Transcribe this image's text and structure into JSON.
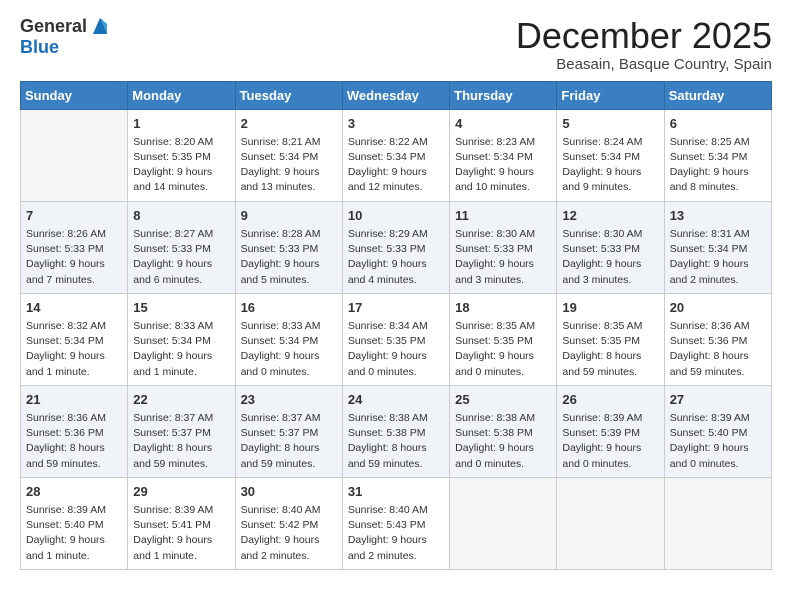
{
  "header": {
    "logo_general": "General",
    "logo_blue": "Blue",
    "month_title": "December 2025",
    "location": "Beasain, Basque Country, Spain"
  },
  "days_of_week": [
    "Sunday",
    "Monday",
    "Tuesday",
    "Wednesday",
    "Thursday",
    "Friday",
    "Saturday"
  ],
  "weeks": [
    [
      {
        "day": "",
        "info": ""
      },
      {
        "day": "1",
        "info": "Sunrise: 8:20 AM\nSunset: 5:35 PM\nDaylight: 9 hours\nand 14 minutes."
      },
      {
        "day": "2",
        "info": "Sunrise: 8:21 AM\nSunset: 5:34 PM\nDaylight: 9 hours\nand 13 minutes."
      },
      {
        "day": "3",
        "info": "Sunrise: 8:22 AM\nSunset: 5:34 PM\nDaylight: 9 hours\nand 12 minutes."
      },
      {
        "day": "4",
        "info": "Sunrise: 8:23 AM\nSunset: 5:34 PM\nDaylight: 9 hours\nand 10 minutes."
      },
      {
        "day": "5",
        "info": "Sunrise: 8:24 AM\nSunset: 5:34 PM\nDaylight: 9 hours\nand 9 minutes."
      },
      {
        "day": "6",
        "info": "Sunrise: 8:25 AM\nSunset: 5:34 PM\nDaylight: 9 hours\nand 8 minutes."
      }
    ],
    [
      {
        "day": "7",
        "info": "Sunrise: 8:26 AM\nSunset: 5:33 PM\nDaylight: 9 hours\nand 7 minutes."
      },
      {
        "day": "8",
        "info": "Sunrise: 8:27 AM\nSunset: 5:33 PM\nDaylight: 9 hours\nand 6 minutes."
      },
      {
        "day": "9",
        "info": "Sunrise: 8:28 AM\nSunset: 5:33 PM\nDaylight: 9 hours\nand 5 minutes."
      },
      {
        "day": "10",
        "info": "Sunrise: 8:29 AM\nSunset: 5:33 PM\nDaylight: 9 hours\nand 4 minutes."
      },
      {
        "day": "11",
        "info": "Sunrise: 8:30 AM\nSunset: 5:33 PM\nDaylight: 9 hours\nand 3 minutes."
      },
      {
        "day": "12",
        "info": "Sunrise: 8:30 AM\nSunset: 5:33 PM\nDaylight: 9 hours\nand 3 minutes."
      },
      {
        "day": "13",
        "info": "Sunrise: 8:31 AM\nSunset: 5:34 PM\nDaylight: 9 hours\nand 2 minutes."
      }
    ],
    [
      {
        "day": "14",
        "info": "Sunrise: 8:32 AM\nSunset: 5:34 PM\nDaylight: 9 hours\nand 1 minute."
      },
      {
        "day": "15",
        "info": "Sunrise: 8:33 AM\nSunset: 5:34 PM\nDaylight: 9 hours\nand 1 minute."
      },
      {
        "day": "16",
        "info": "Sunrise: 8:33 AM\nSunset: 5:34 PM\nDaylight: 9 hours\nand 0 minutes."
      },
      {
        "day": "17",
        "info": "Sunrise: 8:34 AM\nSunset: 5:35 PM\nDaylight: 9 hours\nand 0 minutes."
      },
      {
        "day": "18",
        "info": "Sunrise: 8:35 AM\nSunset: 5:35 PM\nDaylight: 9 hours\nand 0 minutes."
      },
      {
        "day": "19",
        "info": "Sunrise: 8:35 AM\nSunset: 5:35 PM\nDaylight: 8 hours\nand 59 minutes."
      },
      {
        "day": "20",
        "info": "Sunrise: 8:36 AM\nSunset: 5:36 PM\nDaylight: 8 hours\nand 59 minutes."
      }
    ],
    [
      {
        "day": "21",
        "info": "Sunrise: 8:36 AM\nSunset: 5:36 PM\nDaylight: 8 hours\nand 59 minutes."
      },
      {
        "day": "22",
        "info": "Sunrise: 8:37 AM\nSunset: 5:37 PM\nDaylight: 8 hours\nand 59 minutes."
      },
      {
        "day": "23",
        "info": "Sunrise: 8:37 AM\nSunset: 5:37 PM\nDaylight: 8 hours\nand 59 minutes."
      },
      {
        "day": "24",
        "info": "Sunrise: 8:38 AM\nSunset: 5:38 PM\nDaylight: 8 hours\nand 59 minutes."
      },
      {
        "day": "25",
        "info": "Sunrise: 8:38 AM\nSunset: 5:38 PM\nDaylight: 9 hours\nand 0 minutes."
      },
      {
        "day": "26",
        "info": "Sunrise: 8:39 AM\nSunset: 5:39 PM\nDaylight: 9 hours\nand 0 minutes."
      },
      {
        "day": "27",
        "info": "Sunrise: 8:39 AM\nSunset: 5:40 PM\nDaylight: 9 hours\nand 0 minutes."
      }
    ],
    [
      {
        "day": "28",
        "info": "Sunrise: 8:39 AM\nSunset: 5:40 PM\nDaylight: 9 hours\nand 1 minute."
      },
      {
        "day": "29",
        "info": "Sunrise: 8:39 AM\nSunset: 5:41 PM\nDaylight: 9 hours\nand 1 minute."
      },
      {
        "day": "30",
        "info": "Sunrise: 8:40 AM\nSunset: 5:42 PM\nDaylight: 9 hours\nand 2 minutes."
      },
      {
        "day": "31",
        "info": "Sunrise: 8:40 AM\nSunset: 5:43 PM\nDaylight: 9 hours\nand 2 minutes."
      },
      {
        "day": "",
        "info": ""
      },
      {
        "day": "",
        "info": ""
      },
      {
        "day": "",
        "info": ""
      }
    ]
  ]
}
